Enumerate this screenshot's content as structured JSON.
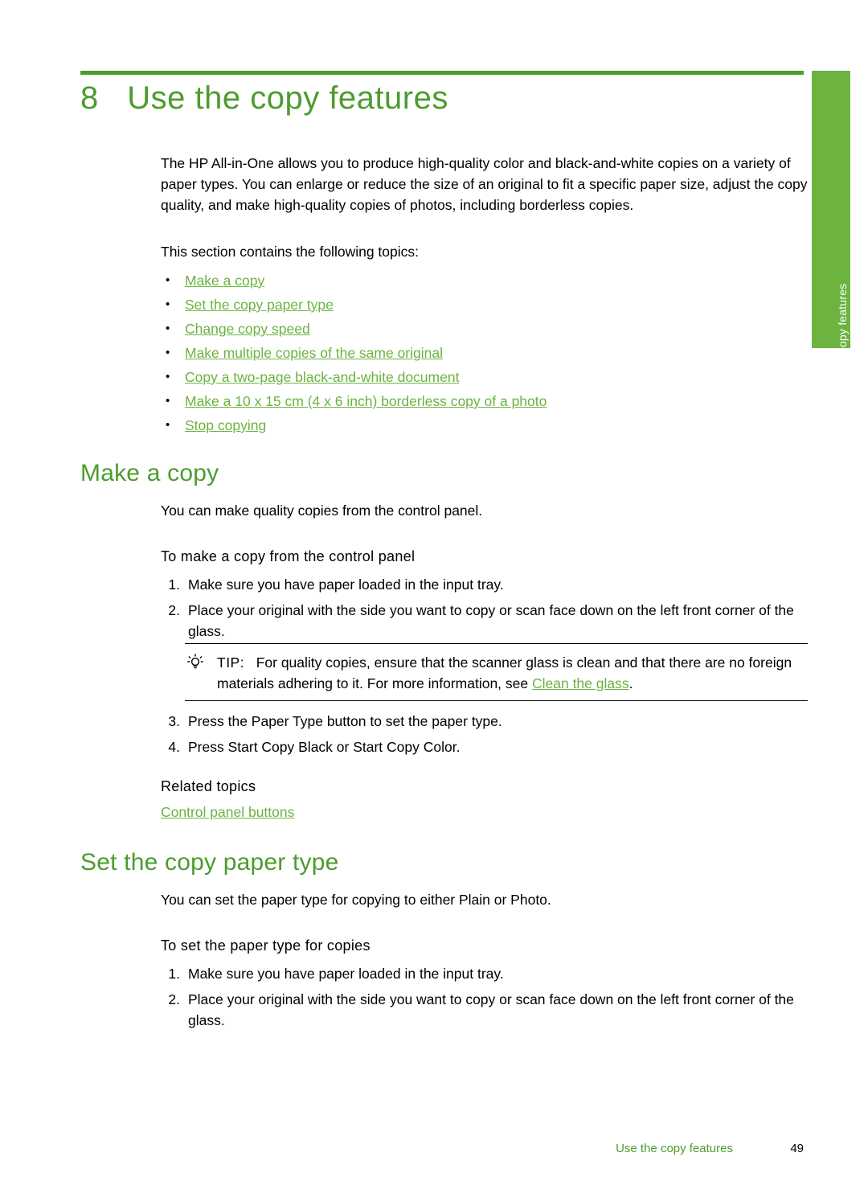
{
  "chapter": {
    "number": "8",
    "title": "Use the copy features"
  },
  "side_tab": {
    "label": "Use the copy features"
  },
  "intro": {
    "paragraph": "The HP All-in-One allows you to produce high-quality color and black-and-white copies on a variety of paper types. You can enlarge or reduce the size of an original to fit a specific paper size, adjust the copy quality, and make high-quality copies of photos, including borderless copies.",
    "topics_lead": "This section contains the following topics:",
    "topics": [
      "Make a copy",
      "Set the copy paper type",
      "Change copy speed",
      "Make multiple copies of the same original",
      "Copy a two-page black-and-white document",
      "Make a 10 x 15 cm (4 x 6 inch) borderless copy of a photo",
      "Stop copying"
    ]
  },
  "make_a_copy": {
    "heading": "Make a copy",
    "intro": "You can make quality copies from the control panel.",
    "procedure_heading": "To make a copy from the control panel",
    "steps_before_tip": [
      {
        "num": "1.",
        "text": "Make sure you have paper loaded in the input tray."
      },
      {
        "num": "2.",
        "text": "Place your original with the side you want to copy or scan face down on the left front corner of the glass."
      }
    ],
    "tip": {
      "label": "TIP:",
      "text_before_link": "For quality copies, ensure that the scanner glass is clean and that there are no foreign materials adhering to it. For more information, see ",
      "link": "Clean the glass",
      "text_after_link": "."
    },
    "steps_after_tip": [
      {
        "num": "3.",
        "text": "Press the Paper Type button to set the paper type."
      },
      {
        "num": "4.",
        "text": "Press Start Copy Black or Start Copy Color."
      }
    ],
    "related_heading": "Related topics",
    "related_link": "Control panel buttons"
  },
  "set_paper_type": {
    "heading": "Set the copy paper type",
    "intro": "You can set the paper type for copying to either Plain or Photo.",
    "procedure_heading": "To set the paper type for copies",
    "steps": [
      {
        "num": "1.",
        "text": "Make sure you have paper loaded in the input tray."
      },
      {
        "num": "2.",
        "text": "Place your original with the side you want to copy or scan face down on the left front corner of the glass."
      }
    ]
  },
  "footer": {
    "title": "Use the copy features",
    "page": "49"
  },
  "colors": {
    "heading_green": "#4c9c2e",
    "link_green": "#6cb33f",
    "tab_green": "#6cb33f"
  }
}
